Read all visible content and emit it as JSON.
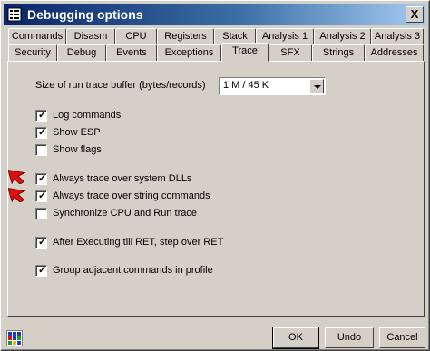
{
  "window": {
    "title": "Debugging options",
    "close_label": "X"
  },
  "tabs_row1": [
    "Commands",
    "Disasm",
    "CPU",
    "Registers",
    "Stack",
    "Analysis 1",
    "Analysis 2",
    "Analysis 3"
  ],
  "tabs_row2": [
    "Security",
    "Debug",
    "Events",
    "Exceptions",
    "Trace",
    "SFX",
    "Strings",
    "Addresses"
  ],
  "active_tab": "Trace",
  "trace": {
    "buffer_label": "Size of run trace buffer (bytes/records)",
    "buffer_value": "1 M / 45 K",
    "options": [
      {
        "label": "Log commands",
        "checked": true
      },
      {
        "label": "Show ESP",
        "checked": true
      },
      {
        "label": "Show flags",
        "checked": false
      },
      {
        "label": "Always trace over system DLLs",
        "checked": true
      },
      {
        "label": "Always trace over string commands",
        "checked": true
      },
      {
        "label": "Synchronize CPU and Run trace",
        "checked": false
      },
      {
        "label": "After Executing till RET, step over RET",
        "checked": true
      },
      {
        "label": "Group adjacent commands in profile",
        "checked": true
      }
    ]
  },
  "buttons": {
    "ok": "OK",
    "undo": "Undo",
    "cancel": "Cancel"
  },
  "colors": {
    "title_start": "#0a246a",
    "title_end": "#a6caf0",
    "face": "#d4d0c8",
    "arrow": "#e01010"
  },
  "icons": {
    "app": "grid-app-icon",
    "status": "color-grid-icon",
    "arrow": "red-pointer-arrow-icon"
  }
}
